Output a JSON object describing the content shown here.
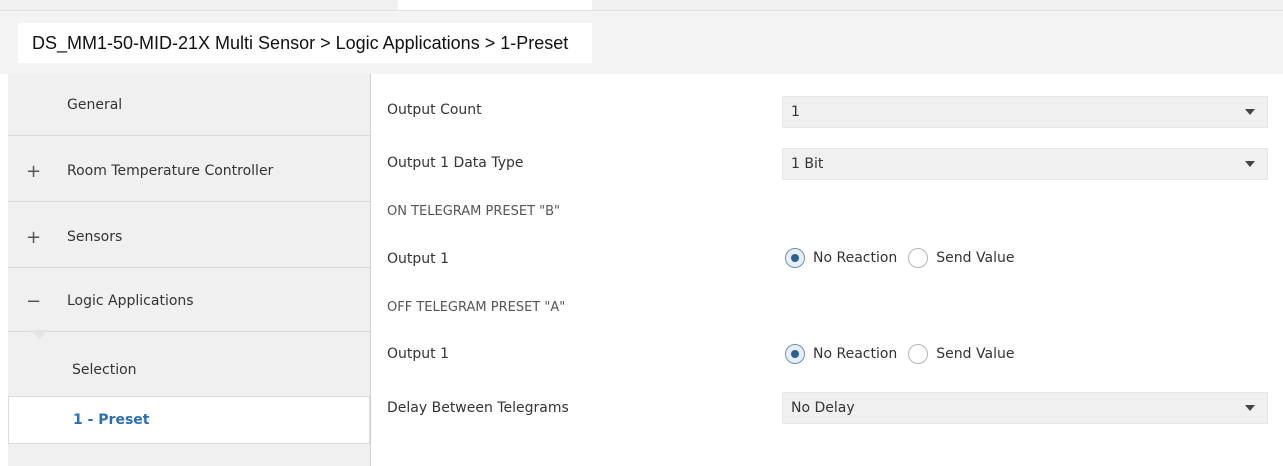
{
  "breadcrumb": {
    "text": "DS_MM1-50-MID-21X Multi Sensor > Logic Applications > 1-Preset"
  },
  "sidebar": {
    "items": [
      {
        "prefix": "",
        "label": "General"
      },
      {
        "prefix": "+",
        "label": "Room Temperature Controller"
      },
      {
        "prefix": "+",
        "label": "Sensors"
      },
      {
        "prefix": "−",
        "label": "Logic Applications"
      }
    ],
    "sub_items": [
      {
        "label": "Selection",
        "active": false
      },
      {
        "label": "1 - Preset",
        "active": true
      }
    ]
  },
  "main": {
    "output_count": {
      "label": "Output Count",
      "value": "1"
    },
    "output1_data_type": {
      "label": "Output 1 Data Type",
      "value": "1 Bit"
    },
    "on_section": {
      "heading": "ON TELEGRAM PRESET \"B\"",
      "output_label": "Output 1",
      "options": [
        "No Reaction",
        "Send Value"
      ],
      "selected": "No Reaction"
    },
    "off_section": {
      "heading": "OFF TELEGRAM PRESET \"A\"",
      "output_label": "Output 1",
      "options": [
        "No Reaction",
        "Send Value"
      ],
      "selected": "No Reaction"
    },
    "delay": {
      "label": "Delay Between Telegrams",
      "value": "No Delay"
    }
  },
  "colors": {
    "active_link": "#2a6fb0",
    "radio_selected": "#2e5e96",
    "sidebar_bg": "#f0f0f0",
    "field_bg": "#f0f0f0"
  },
  "icons": {
    "dropdown": "chevron-down-icon",
    "expand": "plus-icon",
    "collapse": "minus-icon"
  }
}
